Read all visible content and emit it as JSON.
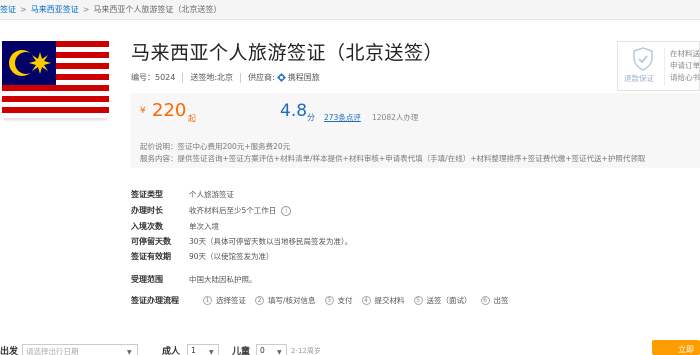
{
  "breadcrumb": {
    "items": [
      "签证",
      "马来西亚签证"
    ],
    "current": "马来西亚个人旅游签证（北京送签）"
  },
  "product": {
    "title": "马来西亚个人旅游签证（北京送签）",
    "code_label": "编号：5024",
    "location_label": "送签地:北京",
    "supplier_label": "供应商:",
    "supplier_name": "携程国旅"
  },
  "guarantee": {
    "label": "退款保证",
    "lines": [
      "在材料送",
      "申请订单",
      "请给心书"
    ]
  },
  "pricing": {
    "currency": "¥",
    "price": "220",
    "price_unit": "起",
    "score": "4.8",
    "score_unit": "分",
    "reviews": "273条点评",
    "handled": "12082人办理",
    "price_note": "起价说明：签证中心费用200元+服务费20元",
    "service_note": "服务内容：提供签证咨询+签证方案评估+材料清单/样本提供+材料审核+申请表代填（手填/在线）+材料整理排序+签证费代缴+签证代送+护照代领取"
  },
  "details": [
    {
      "key": "签证类型",
      "value": "个人旅游签证"
    },
    {
      "key": "办理时长",
      "value": "收齐材料后至少5个工作日"
    },
    {
      "key": "入境次数",
      "value": "单次入境"
    },
    {
      "key": "可停留天数",
      "value": "30天（具体可停留天数以当地移民局签发为准）。"
    },
    {
      "key": "签证有效期",
      "value": "90天（以使馆签发为准）"
    },
    {
      "key": "受理范围",
      "value": "中国大陆因私护照。"
    }
  ],
  "process": {
    "label": "签证办理流程",
    "steps": [
      {
        "num": "1",
        "label": "选择签证"
      },
      {
        "num": "2",
        "label": "填写/核对信息"
      },
      {
        "num": "3",
        "label": "支付"
      },
      {
        "num": "4",
        "label": "提交材料"
      },
      {
        "num": "5",
        "label": "送签（面试）"
      },
      {
        "num": "6",
        "label": "出签"
      }
    ]
  },
  "booking": {
    "date_label": "出发",
    "date_placeholder": "请选择出行日期",
    "adult_label": "成人",
    "adult_value": "1",
    "child_label": "儿童",
    "child_value": "0",
    "child_note": "2-12周岁",
    "book_button": "立即预"
  },
  "colors": {
    "accent_orange": "#ff6600",
    "link_blue": "#0069ca",
    "button_orange": "#ff9d00"
  }
}
